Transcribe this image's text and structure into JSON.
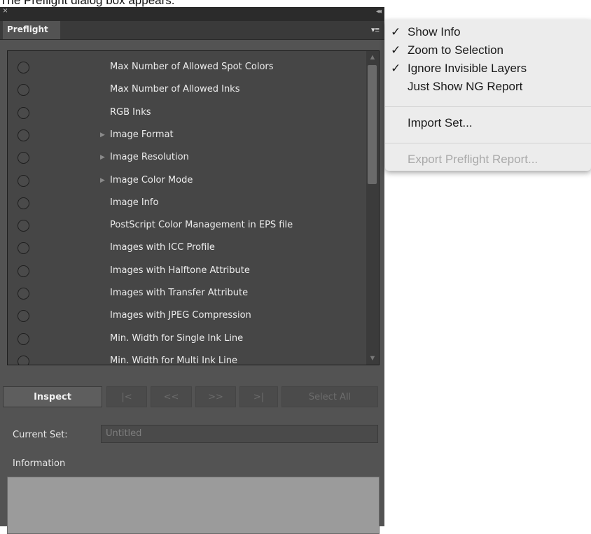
{
  "caption": "The Preflight dialog box appears.",
  "panel": {
    "close_glyph": "×",
    "collapse_glyph": "◂◂",
    "tab_label": "Preflight",
    "menu_glyph": "▾≡",
    "rows": [
      {
        "label": "Max Number of  Allowed Spot Colors",
        "expandable": false
      },
      {
        "label": "Max Number of  Allowed Inks",
        "expandable": false
      },
      {
        "label": "RGB Inks",
        "expandable": false
      },
      {
        "label": "Image Format",
        "expandable": true
      },
      {
        "label": "Image Resolution",
        "expandable": true
      },
      {
        "label": "Image Color Mode",
        "expandable": true
      },
      {
        "label": "Image Info",
        "expandable": false
      },
      {
        "label": "PostScript Color Management in EPS file",
        "expandable": false
      },
      {
        "label": "Images with ICC Profile",
        "expandable": false
      },
      {
        "label": "Images with Halftone Attribute",
        "expandable": false
      },
      {
        "label": "Images with Transfer Attribute",
        "expandable": false
      },
      {
        "label": "Images with JPEG Compression",
        "expandable": false
      },
      {
        "label": "Min. Width for Single Ink Line",
        "expandable": false
      },
      {
        "label": "Min. Width for Multi Ink Line",
        "expandable": false
      }
    ],
    "buttons": {
      "inspect": "Inspect",
      "first": "|<",
      "prev": "<<",
      "next": ">>",
      "last": ">|",
      "select_all": "Select All"
    },
    "current_set_label": "Current Set:",
    "current_set_value": "Untitled",
    "information_label": "Information"
  },
  "menu": {
    "items": [
      {
        "label": "Show Info",
        "checked": true,
        "enabled": true
      },
      {
        "label": "Zoom to Selection",
        "checked": true,
        "enabled": true
      },
      {
        "label": "Ignore Invisible Layers",
        "checked": true,
        "enabled": true
      },
      {
        "label": "Just Show NG Report",
        "checked": false,
        "enabled": true
      },
      {
        "label": "Import Set...",
        "checked": false,
        "enabled": true
      },
      {
        "label": "Export Preflight Report...",
        "checked": false,
        "enabled": false
      }
    ],
    "check_glyph": "✓"
  }
}
